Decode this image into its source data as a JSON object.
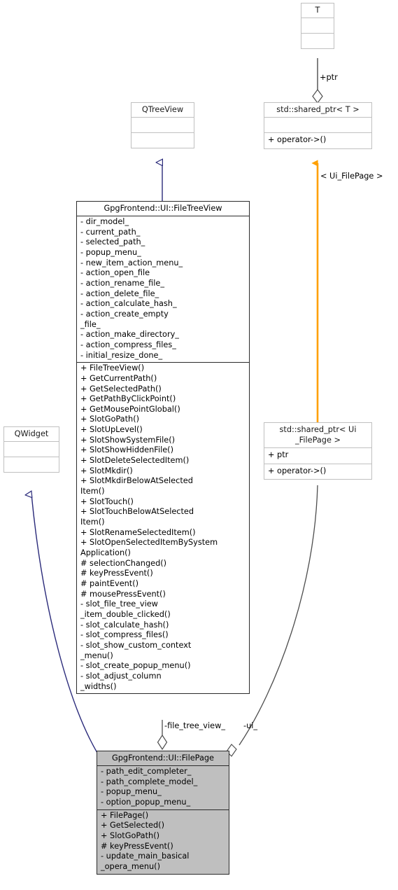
{
  "diagram": {
    "kind": "uml-class-diagram",
    "background": "#ffffff"
  },
  "colors": {
    "external_border": "#c0c0c0",
    "own_border": "#2b2b2b",
    "filled_node_bg": "#bfbfbf",
    "inheritance_edge": "#2a2a7a",
    "aggregation_edge": "#4d4d4d",
    "template_edge": "#ffa000",
    "text": "#000000"
  },
  "nodes": {
    "t_param": {
      "title": "T",
      "attributes": [],
      "operations": []
    },
    "qtreeview": {
      "title": "QTreeView",
      "attributes": [],
      "operations": []
    },
    "shared_ptr_t": {
      "title": "std::shared_ptr< T >",
      "attributes": [],
      "operations": [
        "+ operator->()"
      ]
    },
    "shared_ptr_ui_filepage": {
      "title": "std::shared_ptr< Ui\n_FilePage >",
      "attributes": [
        "+ ptr"
      ],
      "operations": [
        "+ operator->()"
      ]
    },
    "qwidget": {
      "title": "QWidget",
      "attributes": [],
      "operations": []
    },
    "file_tree_view": {
      "title": "GpgFrontend::UI::FileTreeView",
      "attributes": [
        "- dir_model_",
        "- current_path_",
        "- selected_path_",
        "- popup_menu_",
        "- new_item_action_menu_",
        "- action_open_file",
        "- action_rename_file_",
        "- action_delete_file_",
        "- action_calculate_hash_",
        "- action_create_empty\n_file_",
        "- action_make_directory_",
        "- action_compress_files_",
        "- initial_resize_done_"
      ],
      "operations": [
        "+ FileTreeView()",
        "+ GetCurrentPath()",
        "+ GetSelectedPath()",
        "+ GetPathByClickPoint()",
        "+ GetMousePointGlobal()",
        "+ SlotGoPath()",
        "+ SlotUpLevel()",
        "+ SlotShowSystemFile()",
        "+ SlotShowHiddenFile()",
        "+ SlotDeleteSelectedItem()",
        "+ SlotMkdir()",
        "+ SlotMkdirBelowAtSelected\nItem()",
        "+ SlotTouch()",
        "+ SlotTouchBelowAtSelected\nItem()",
        "+ SlotRenameSelectedItem()",
        "+ SlotOpenSelectedItemBySystem\nApplication()",
        "# selectionChanged()",
        "# keyPressEvent()",
        "# paintEvent()",
        "# mousePressEvent()",
        "- slot_file_tree_view\n_item_double_clicked()",
        "- slot_calculate_hash()",
        "- slot_compress_files()",
        "- slot_show_custom_context\n_menu()",
        "- slot_create_popup_menu()",
        "- slot_adjust_column\n_widths()"
      ]
    },
    "file_page": {
      "title": "GpgFrontend::UI::FilePage",
      "attributes": [
        "- path_edit_completer_",
        "- path_complete_model_",
        "- popup_menu_",
        "- option_popup_menu_"
      ],
      "operations": [
        "+ FilePage()",
        "+ GetSelected()",
        "+ SlotGoPath()",
        "# keyPressEvent()",
        "- update_main_basical\n_opera_menu()"
      ]
    }
  },
  "edge_labels": {
    "ptr": "+ptr",
    "ui_filepage_binding": "< Ui_FilePage >",
    "file_tree_view_member": "-file_tree_view_",
    "ui_member": "-ui_"
  }
}
